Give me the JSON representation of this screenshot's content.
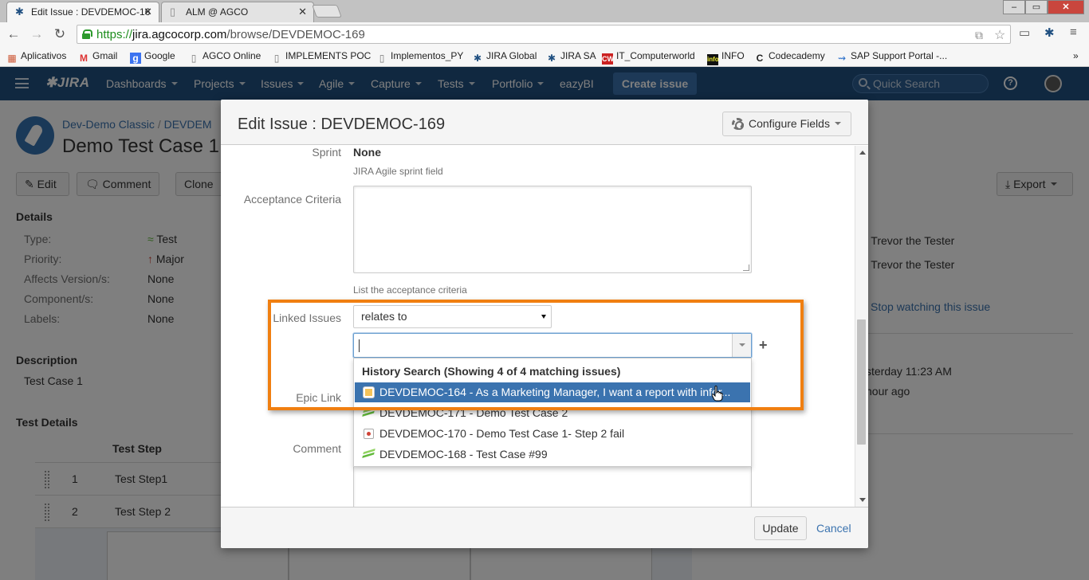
{
  "browser": {
    "tabs": [
      {
        "title": "Edit Issue : DEVDEMOC-16",
        "active": true
      },
      {
        "title": "ALM @ AGCO",
        "active": false
      }
    ],
    "url_scheme": "https://",
    "url_host": "jira.agcocorp.com",
    "url_path": "/browse/DEVDEMOC-169",
    "bookmarks": [
      "Aplicativos",
      "Gmail",
      "Google",
      "AGCO Online",
      "IMPLEMENTS POC",
      "Implementos_PY",
      "JIRA Global",
      "JIRA SA",
      "IT_Computerworld",
      "INFO",
      "Codecademy",
      "SAP Support Portal -..."
    ],
    "overflow": "»"
  },
  "jira": {
    "logo": "JIRA",
    "nav": [
      "Dashboards",
      "Projects",
      "Issues",
      "Agile",
      "Capture",
      "Tests",
      "Portfolio",
      "eazyBI"
    ],
    "create_label": "Create issue",
    "search_placeholder": "Quick Search",
    "help": "?"
  },
  "page": {
    "breadcrumb": [
      "Dev-Demo Classic",
      "/",
      "DEVDEM"
    ],
    "title": "Demo Test Case 1",
    "ops": [
      "Edit",
      "Comment",
      "Clone"
    ],
    "export_label": "Export",
    "details_heading": "Details",
    "details": [
      {
        "label": "Type:",
        "value": "Test"
      },
      {
        "label": "Priority:",
        "value": "Major"
      },
      {
        "label": "Affects Version/s:",
        "value": "None"
      },
      {
        "label": "Component/s:",
        "value": "None"
      },
      {
        "label": "Labels:",
        "value": "None"
      }
    ],
    "description_heading": "Description",
    "description": "Test Case 1",
    "test_details_heading": "Test Details",
    "test_step_header": "Test Step",
    "steps": [
      {
        "num": "1",
        "text": "Test Step1"
      },
      {
        "num": "2",
        "text": "Test Step 2"
      }
    ],
    "people": [
      ") Trevor the Tester",
      ") Trevor the Tester"
    ],
    "stop_watching": "Stop watching this issue",
    "dates": [
      "sterday 11:23 AM",
      "hour ago"
    ]
  },
  "modal": {
    "title": "Edit Issue : DEVDEMOC-169",
    "configure_fields": "Configure Fields",
    "sprint_label": "Sprint",
    "sprint_value": "None",
    "sprint_desc": "JIRA Agile sprint field",
    "acceptance_label": "Acceptance Criteria",
    "acceptance_value": "",
    "acceptance_desc": "List the acceptance criteria",
    "linked_label": "Linked Issues",
    "link_type": "relates to",
    "issue_search_value": "",
    "epic_label": "Epic Link",
    "comment_label": "Comment",
    "update_label": "Update",
    "cancel_label": "Cancel"
  },
  "suggestions": {
    "heading": "History Search (Showing 4 of 4 matching issues)",
    "items": [
      {
        "text": "DEVDEMOC-164 - As a Marketing Manager, I want a report with infor...",
        "icon": "story-icon",
        "selected": true
      },
      {
        "text": "DEVDEMOC-171 - Demo Test Case 2",
        "icon": "test-icon",
        "selected": false
      },
      {
        "text": "DEVDEMOC-170 - Demo Test Case 1- Step 2 fail",
        "icon": "test-execution-icon",
        "selected": false
      },
      {
        "text": "DEVDEMOC-168 - Test Case #99",
        "icon": "test-icon",
        "selected": false
      }
    ]
  },
  "colors": {
    "jira_header": "#205081",
    "accent": "#3b73af",
    "highlight": "#f07f11"
  }
}
